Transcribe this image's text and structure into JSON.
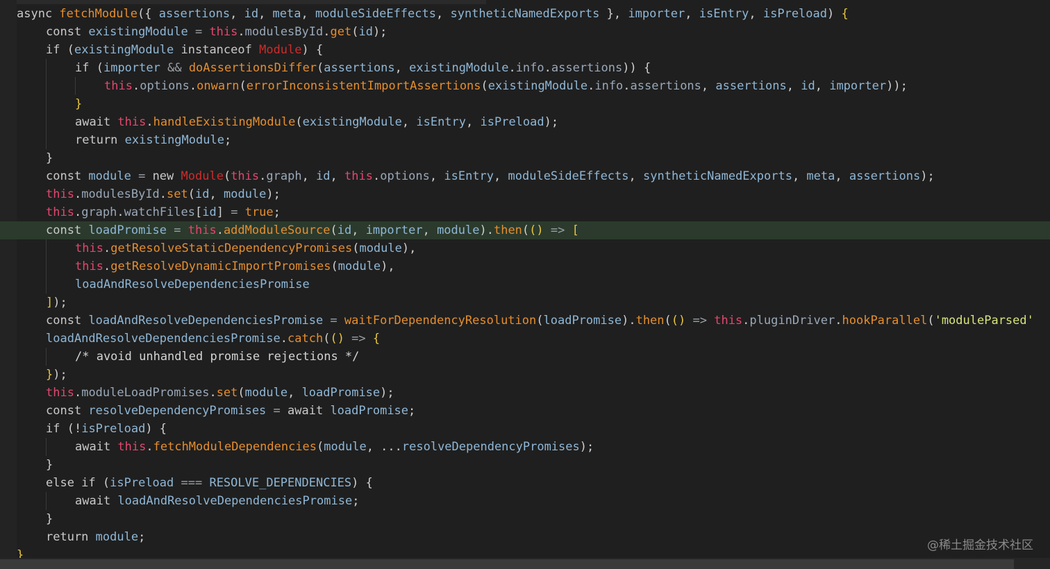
{
  "watermark": "@稀土掘金技术社区",
  "lines": [
    {
      "indent": 0,
      "active": false,
      "tokens": [
        [
          "kw",
          "async "
        ],
        [
          "fn",
          "fetchModule"
        ],
        [
          "pun",
          "({ "
        ],
        [
          "var",
          "assertions"
        ],
        [
          "pun",
          ", "
        ],
        [
          "var",
          "id"
        ],
        [
          "pun",
          ", "
        ],
        [
          "var",
          "meta"
        ],
        [
          "pun",
          ", "
        ],
        [
          "var",
          "moduleSideEffects"
        ],
        [
          "pun",
          ", "
        ],
        [
          "var",
          "syntheticNamedExports"
        ],
        [
          "pun",
          " }, "
        ],
        [
          "var",
          "importer"
        ],
        [
          "pun",
          ", "
        ],
        [
          "var",
          "isEntry"
        ],
        [
          "pun",
          ", "
        ],
        [
          "var",
          "isPreload"
        ],
        [
          "pun",
          ") "
        ],
        [
          "brk",
          "{"
        ]
      ]
    },
    {
      "indent": 1,
      "active": false,
      "tokens": [
        [
          "kw",
          "const "
        ],
        [
          "var",
          "existingModule"
        ],
        [
          "op",
          " = "
        ],
        [
          "this",
          "this"
        ],
        [
          "pun",
          "."
        ],
        [
          "prop",
          "modulesById"
        ],
        [
          "pun",
          "."
        ],
        [
          "fn",
          "get"
        ],
        [
          "pun",
          "("
        ],
        [
          "var",
          "id"
        ],
        [
          "pun",
          ");"
        ]
      ]
    },
    {
      "indent": 1,
      "active": false,
      "tokens": [
        [
          "kw",
          "if "
        ],
        [
          "pun",
          "("
        ],
        [
          "var",
          "existingModule"
        ],
        [
          "kw",
          " instanceof "
        ],
        [
          "cls",
          "Module"
        ],
        [
          "pun",
          ") {"
        ]
      ]
    },
    {
      "indent": 2,
      "active": false,
      "tokens": [
        [
          "kw",
          "if "
        ],
        [
          "pun",
          "("
        ],
        [
          "var",
          "importer"
        ],
        [
          "op",
          " && "
        ],
        [
          "fn",
          "doAssertionsDiffer"
        ],
        [
          "pun",
          "("
        ],
        [
          "var",
          "assertions"
        ],
        [
          "pun",
          ", "
        ],
        [
          "var",
          "existingModule"
        ],
        [
          "pun",
          "."
        ],
        [
          "prop",
          "info"
        ],
        [
          "pun",
          "."
        ],
        [
          "prop",
          "assertions"
        ],
        [
          "pun",
          ")) {"
        ]
      ]
    },
    {
      "indent": 3,
      "active": false,
      "tokens": [
        [
          "this",
          "this"
        ],
        [
          "pun",
          "."
        ],
        [
          "prop",
          "options"
        ],
        [
          "pun",
          "."
        ],
        [
          "fn",
          "onwarn"
        ],
        [
          "pun",
          "("
        ],
        [
          "fn",
          "errorInconsistentImportAssertions"
        ],
        [
          "pun",
          "("
        ],
        [
          "var",
          "existingModule"
        ],
        [
          "pun",
          "."
        ],
        [
          "prop",
          "info"
        ],
        [
          "pun",
          "."
        ],
        [
          "prop",
          "assertions"
        ],
        [
          "pun",
          ", "
        ],
        [
          "var",
          "assertions"
        ],
        [
          "pun",
          ", "
        ],
        [
          "var",
          "id"
        ],
        [
          "pun",
          ", "
        ],
        [
          "var",
          "importer"
        ],
        [
          "pun",
          "));"
        ]
      ]
    },
    {
      "indent": 2,
      "active": false,
      "tokens": [
        [
          "brk",
          "}"
        ]
      ]
    },
    {
      "indent": 2,
      "active": false,
      "tokens": [
        [
          "kw",
          "await "
        ],
        [
          "this",
          "this"
        ],
        [
          "pun",
          "."
        ],
        [
          "fn",
          "handleExistingModule"
        ],
        [
          "pun",
          "("
        ],
        [
          "var",
          "existingModule"
        ],
        [
          "pun",
          ", "
        ],
        [
          "var",
          "isEntry"
        ],
        [
          "pun",
          ", "
        ],
        [
          "var",
          "isPreload"
        ],
        [
          "pun",
          ");"
        ]
      ]
    },
    {
      "indent": 2,
      "active": false,
      "tokens": [
        [
          "kw",
          "return "
        ],
        [
          "var",
          "existingModule"
        ],
        [
          "pun",
          ";"
        ]
      ]
    },
    {
      "indent": 1,
      "active": false,
      "tokens": [
        [
          "pun",
          "}"
        ]
      ]
    },
    {
      "indent": 1,
      "active": false,
      "tokens": [
        [
          "kw",
          "const "
        ],
        [
          "var",
          "module"
        ],
        [
          "op",
          " = "
        ],
        [
          "kw",
          "new "
        ],
        [
          "cls",
          "Module"
        ],
        [
          "pun",
          "("
        ],
        [
          "this",
          "this"
        ],
        [
          "pun",
          "."
        ],
        [
          "prop",
          "graph"
        ],
        [
          "pun",
          ", "
        ],
        [
          "var",
          "id"
        ],
        [
          "pun",
          ", "
        ],
        [
          "this",
          "this"
        ],
        [
          "pun",
          "."
        ],
        [
          "prop",
          "options"
        ],
        [
          "pun",
          ", "
        ],
        [
          "var",
          "isEntry"
        ],
        [
          "pun",
          ", "
        ],
        [
          "var",
          "moduleSideEffects"
        ],
        [
          "pun",
          ", "
        ],
        [
          "var",
          "syntheticNamedExports"
        ],
        [
          "pun",
          ", "
        ],
        [
          "var",
          "meta"
        ],
        [
          "pun",
          ", "
        ],
        [
          "var",
          "assertions"
        ],
        [
          "pun",
          ");"
        ]
      ]
    },
    {
      "indent": 1,
      "active": false,
      "tokens": [
        [
          "this",
          "this"
        ],
        [
          "pun",
          "."
        ],
        [
          "prop",
          "modulesById"
        ],
        [
          "pun",
          "."
        ],
        [
          "fn",
          "set"
        ],
        [
          "pun",
          "("
        ],
        [
          "var",
          "id"
        ],
        [
          "pun",
          ", "
        ],
        [
          "var",
          "module"
        ],
        [
          "pun",
          ");"
        ]
      ]
    },
    {
      "indent": 1,
      "active": false,
      "tokens": [
        [
          "this",
          "this"
        ],
        [
          "pun",
          "."
        ],
        [
          "prop",
          "graph"
        ],
        [
          "pun",
          "."
        ],
        [
          "prop",
          "watchFiles"
        ],
        [
          "pun",
          "["
        ],
        [
          "var",
          "id"
        ],
        [
          "pun",
          "]"
        ],
        [
          "op",
          " = "
        ],
        [
          "bool",
          "true"
        ],
        [
          "pun",
          ";"
        ]
      ]
    },
    {
      "indent": 1,
      "active": true,
      "tokens": [
        [
          "kw",
          "const "
        ],
        [
          "var",
          "loadPromise"
        ],
        [
          "op",
          " = "
        ],
        [
          "this",
          "this"
        ],
        [
          "pun",
          "."
        ],
        [
          "fn",
          "addModuleSource"
        ],
        [
          "pun",
          "("
        ],
        [
          "var",
          "id"
        ],
        [
          "pun",
          ", "
        ],
        [
          "var",
          "importer"
        ],
        [
          "pun",
          ", "
        ],
        [
          "var",
          "module"
        ],
        [
          "pun",
          ")."
        ],
        [
          "fn",
          "then"
        ],
        [
          "pun",
          "("
        ],
        [
          "brk",
          "()"
        ],
        [
          "op",
          " => "
        ],
        [
          "brk",
          "["
        ]
      ]
    },
    {
      "indent": 2,
      "active": false,
      "tokens": [
        [
          "this",
          "this"
        ],
        [
          "pun",
          "."
        ],
        [
          "fn",
          "getResolveStaticDependencyPromises"
        ],
        [
          "pun",
          "("
        ],
        [
          "var",
          "module"
        ],
        [
          "pun",
          "),"
        ]
      ]
    },
    {
      "indent": 2,
      "active": false,
      "tokens": [
        [
          "this",
          "this"
        ],
        [
          "pun",
          "."
        ],
        [
          "fn",
          "getResolveDynamicImportPromises"
        ],
        [
          "pun",
          "("
        ],
        [
          "var",
          "module"
        ],
        [
          "pun",
          "),"
        ]
      ]
    },
    {
      "indent": 2,
      "active": false,
      "tokens": [
        [
          "var",
          "loadAndResolveDependenciesPromise"
        ]
      ]
    },
    {
      "indent": 1,
      "active": false,
      "tokens": [
        [
          "brk",
          "]"
        ],
        [
          "pun",
          ");"
        ]
      ]
    },
    {
      "indent": 1,
      "active": false,
      "tokens": [
        [
          "kw",
          "const "
        ],
        [
          "var",
          "loadAndResolveDependenciesPromise"
        ],
        [
          "op",
          " = "
        ],
        [
          "fn",
          "waitForDependencyResolution"
        ],
        [
          "pun",
          "("
        ],
        [
          "var",
          "loadPromise"
        ],
        [
          "pun",
          ")."
        ],
        [
          "fn",
          "then"
        ],
        [
          "pun",
          "("
        ],
        [
          "brk",
          "()"
        ],
        [
          "op",
          " => "
        ],
        [
          "this",
          "this"
        ],
        [
          "pun",
          "."
        ],
        [
          "prop",
          "pluginDriver"
        ],
        [
          "pun",
          "."
        ],
        [
          "fn",
          "hookParallel"
        ],
        [
          "pun",
          "("
        ],
        [
          "str",
          "'moduleParsed'"
        ]
      ]
    },
    {
      "indent": 1,
      "active": false,
      "tokens": [
        [
          "var",
          "loadAndResolveDependenciesPromise"
        ],
        [
          "pun",
          "."
        ],
        [
          "fn",
          "catch"
        ],
        [
          "pun",
          "("
        ],
        [
          "brk",
          "()"
        ],
        [
          "op",
          " => "
        ],
        [
          "brk",
          "{"
        ]
      ]
    },
    {
      "indent": 2,
      "active": false,
      "tokens": [
        [
          "cmt",
          "/* avoid unhandled promise rejections */"
        ]
      ]
    },
    {
      "indent": 1,
      "active": false,
      "tokens": [
        [
          "brk",
          "}"
        ],
        [
          "pun",
          ");"
        ]
      ]
    },
    {
      "indent": 1,
      "active": false,
      "tokens": [
        [
          "this",
          "this"
        ],
        [
          "pun",
          "."
        ],
        [
          "prop",
          "moduleLoadPromises"
        ],
        [
          "pun",
          "."
        ],
        [
          "fn",
          "set"
        ],
        [
          "pun",
          "("
        ],
        [
          "var",
          "module"
        ],
        [
          "pun",
          ", "
        ],
        [
          "var",
          "loadPromise"
        ],
        [
          "pun",
          ");"
        ]
      ]
    },
    {
      "indent": 1,
      "active": false,
      "tokens": [
        [
          "kw",
          "const "
        ],
        [
          "var",
          "resolveDependencyPromises"
        ],
        [
          "op",
          " = "
        ],
        [
          "kw",
          "await "
        ],
        [
          "var",
          "loadPromise"
        ],
        [
          "pun",
          ";"
        ]
      ]
    },
    {
      "indent": 1,
      "active": false,
      "tokens": [
        [
          "kw",
          "if "
        ],
        [
          "pun",
          "(!"
        ],
        [
          "var",
          "isPreload"
        ],
        [
          "pun",
          ") {"
        ]
      ]
    },
    {
      "indent": 2,
      "active": false,
      "tokens": [
        [
          "kw",
          "await "
        ],
        [
          "this",
          "this"
        ],
        [
          "pun",
          "."
        ],
        [
          "fn",
          "fetchModuleDependencies"
        ],
        [
          "pun",
          "("
        ],
        [
          "var",
          "module"
        ],
        [
          "pun",
          ", ..."
        ],
        [
          "var",
          "resolveDependencyPromises"
        ],
        [
          "pun",
          ");"
        ]
      ]
    },
    {
      "indent": 1,
      "active": false,
      "tokens": [
        [
          "pun",
          "}"
        ]
      ]
    },
    {
      "indent": 1,
      "active": false,
      "tokens": [
        [
          "kw",
          "else if "
        ],
        [
          "pun",
          "("
        ],
        [
          "var",
          "isPreload"
        ],
        [
          "op",
          " === "
        ],
        [
          "const",
          "RESOLVE_DEPENDENCIES"
        ],
        [
          "pun",
          ") {"
        ]
      ]
    },
    {
      "indent": 2,
      "active": false,
      "tokens": [
        [
          "kw",
          "await "
        ],
        [
          "var",
          "loadAndResolveDependenciesPromise"
        ],
        [
          "pun",
          ";"
        ]
      ]
    },
    {
      "indent": 1,
      "active": false,
      "tokens": [
        [
          "pun",
          "}"
        ]
      ]
    },
    {
      "indent": 1,
      "active": false,
      "tokens": [
        [
          "kw",
          "return "
        ],
        [
          "var",
          "module"
        ],
        [
          "pun",
          ";"
        ]
      ]
    },
    {
      "indent": 0,
      "active": false,
      "tokens": [
        [
          "brk",
          "}"
        ]
      ]
    }
  ]
}
